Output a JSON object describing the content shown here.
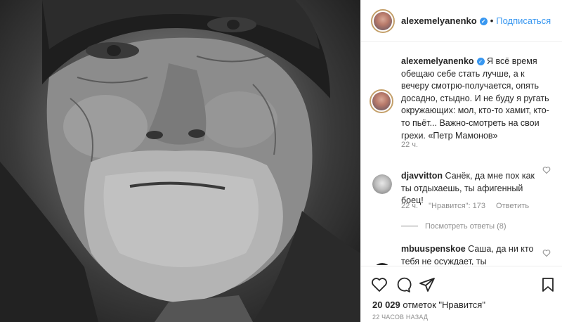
{
  "photo": {
    "description_icon": "portrait-photo"
  },
  "header": {
    "username": "alexemelyanenko",
    "separator": "•",
    "follow_label": "Подписаться",
    "verified_glyph": "✓"
  },
  "caption": {
    "username": "alexemelyanenko",
    "text": "Я всё время обещаю себе стать лучше, а к вечеру смотрю-получается, опять досадно, стыдно. И не буду я ругать окружающих: мол, кто-то хамит, кто-то пьёт... Важно-смотреть на свои грехи. «Петр Мамонов»",
    "time": "22 ч."
  },
  "comments": [
    {
      "username": "djavvitton",
      "text": "Санёк, да мне пох как ты отдыхаешь, ты афигенный боец!",
      "time": "22 ч.",
      "likes": "\"Нравится\": 173",
      "reply_label": "Ответить",
      "view_replies": "Посмотреть ответы (8)"
    },
    {
      "username": "mbuuspenskoe",
      "text": "Саша, да ни кто тебя не осуждает, ты"
    }
  ],
  "actions": {
    "likes_count": "20 029",
    "likes_suffix": "отметок \"Нравится\"",
    "posted": "22 ЧАСОВ НАЗАД"
  }
}
